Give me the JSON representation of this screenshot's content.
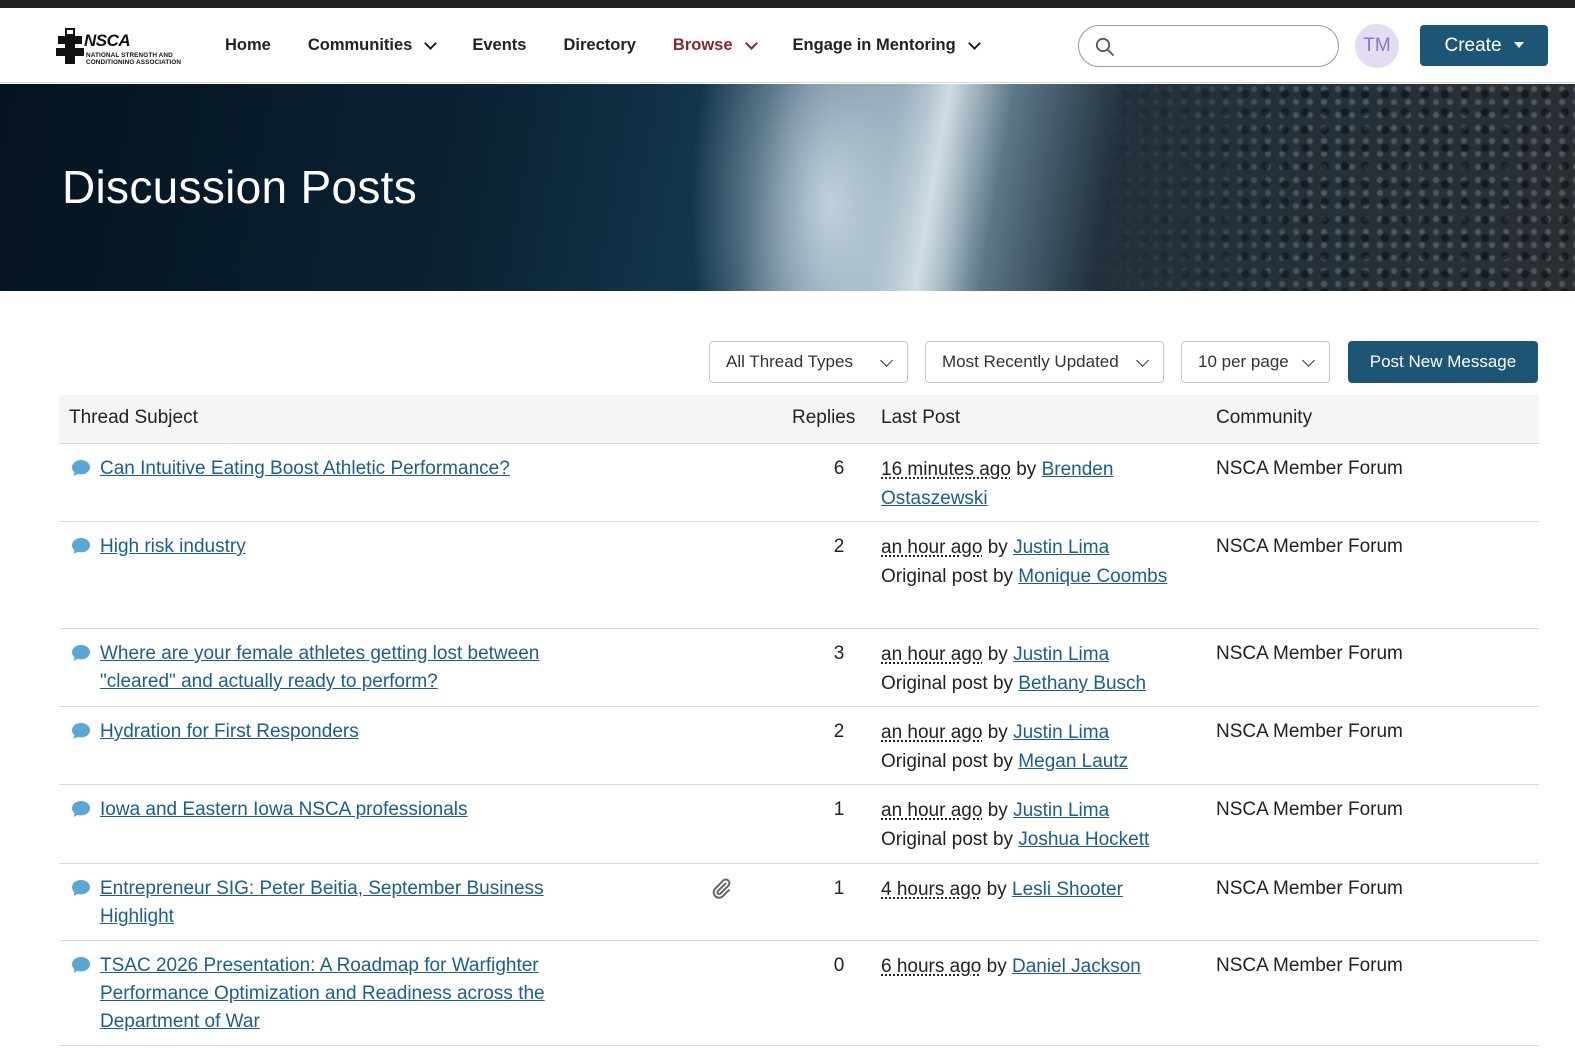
{
  "header": {
    "logo_text": "NSCA",
    "logo_subtext": "NATIONAL STRENGTH AND CONDITIONING ASSOCIATION",
    "nav": [
      {
        "label": "Home",
        "dropdown": false,
        "active": false
      },
      {
        "label": "Communities",
        "dropdown": true,
        "active": false
      },
      {
        "label": "Events",
        "dropdown": false,
        "active": false
      },
      {
        "label": "Directory",
        "dropdown": false,
        "active": false
      },
      {
        "label": "Browse",
        "dropdown": true,
        "active": true
      },
      {
        "label": "Engage in Mentoring",
        "dropdown": true,
        "active": false
      }
    ],
    "search_placeholder": "",
    "avatar_initials": "TM",
    "create_label": "Create"
  },
  "banner": {
    "title": "Discussion Posts"
  },
  "filters": {
    "thread_type": "All Thread Types",
    "sort": "Most Recently Updated",
    "per_page": "10 per page",
    "post_button": "Post New Message"
  },
  "table": {
    "columns": {
      "subject": "Thread Subject",
      "replies": "Replies",
      "last_post": "Last Post",
      "community": "Community"
    },
    "rows": [
      {
        "subject": "Can Intuitive Eating Boost Athletic Performance?",
        "attachment": false,
        "replies": "6",
        "ago": "16 minutes ago",
        "by_label": "by",
        "author": "Brenden Ostaszewski",
        "original_label": "",
        "original_author": "",
        "community": "NSCA Member Forum"
      },
      {
        "subject": "High risk industry",
        "attachment": false,
        "replies": "2",
        "ago": "an hour ago",
        "by_label": "by",
        "author": "Justin Lima",
        "original_label": "Original post by",
        "original_author": "Monique Coombs",
        "community": "NSCA Member Forum"
      },
      {
        "subject": "Where are your female athletes getting lost between \"cleared\" and actually ready to perform?",
        "attachment": false,
        "replies": "3",
        "ago": "an hour ago",
        "by_label": "by",
        "author": "Justin Lima",
        "original_label": "Original post by",
        "original_author": "Bethany Busch",
        "community": "NSCA Member Forum"
      },
      {
        "subject": "Hydration for First Responders",
        "attachment": false,
        "replies": "2",
        "ago": "an hour ago",
        "by_label": "by",
        "author": "Justin Lima",
        "original_label": "Original post by",
        "original_author": "Megan Lautz",
        "community": "NSCA Member Forum"
      },
      {
        "subject": "Iowa and Eastern Iowa NSCA professionals",
        "attachment": false,
        "replies": "1",
        "ago": "an hour ago",
        "by_label": "by",
        "author": "Justin Lima",
        "original_label": "Original post by",
        "original_author": "Joshua Hockett",
        "community": "NSCA Member Forum"
      },
      {
        "subject": "Entrepreneur SIG: Peter Beitia, September Business Highlight",
        "attachment": true,
        "replies": "1",
        "ago": "4 hours ago",
        "by_label": "by",
        "author": "Lesli Shooter",
        "original_label": "",
        "original_author": "",
        "community": "NSCA Member Forum"
      },
      {
        "subject": "TSAC 2026 Presentation: A Roadmap for Warfighter Performance Optimization and Readiness across the Department of War",
        "attachment": false,
        "replies": "0",
        "ago": "6 hours ago",
        "by_label": "by",
        "author": "Daniel Jackson",
        "original_label": "",
        "original_author": "",
        "community": "NSCA Member Forum"
      }
    ]
  },
  "colors": {
    "primary_button": "#1d5674",
    "link": "#1b5e8c",
    "active_nav": "#8a2630",
    "bubble_icon": "#5aa7d6",
    "avatar_bg": "#e4dcf3"
  }
}
